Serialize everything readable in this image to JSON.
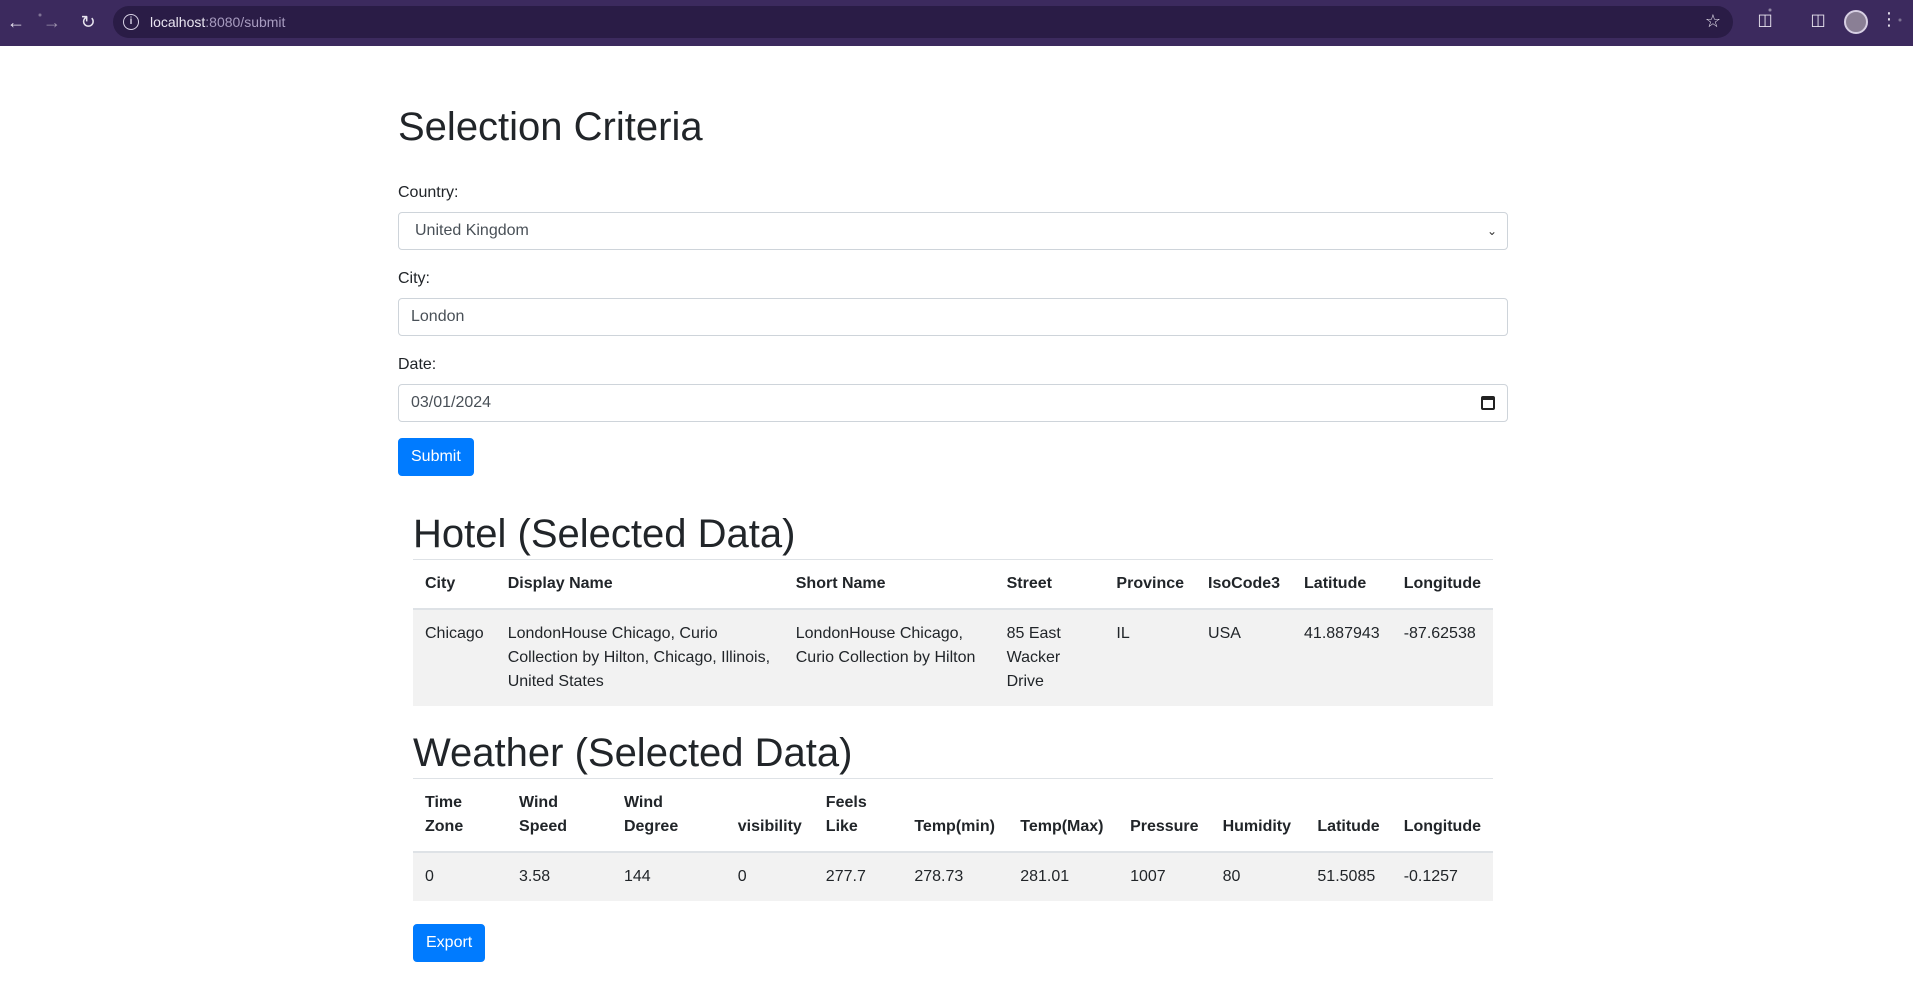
{
  "browser": {
    "url_host": "localhost",
    "url_path": ":8080/submit"
  },
  "form": {
    "title": "Selection Criteria",
    "country_label": "Country:",
    "country_value": "United Kingdom",
    "city_label": "City:",
    "city_value": "London",
    "date_label": "Date:",
    "date_value": "03/01/2024",
    "submit_label": "Submit"
  },
  "hotel": {
    "title": "Hotel (Selected Data)",
    "columns": [
      "City",
      "Display Name",
      "Short Name",
      "Street",
      "Province",
      "IsoCode3",
      "Latitude",
      "Longitude"
    ],
    "row": {
      "city": "Chicago",
      "display_name": "LondonHouse Chicago, Curio Collection by Hilton, Chicago, Illinois, United States",
      "short_name": "LondonHouse Chicago, Curio Collection by Hilton",
      "street": "85 East Wacker Drive",
      "province": "IL",
      "iso_code3": "USA",
      "latitude": "41.887943",
      "longitude": "-87.62538"
    }
  },
  "weather": {
    "title": "Weather (Selected Data)",
    "columns": [
      "Time Zone",
      "Wind Speed",
      "Wind Degree",
      "visibility",
      "Feels Like",
      "Temp(min)",
      "Temp(Max)",
      "Pressure",
      "Humidity",
      "Latitude",
      "Longitude"
    ],
    "row": {
      "time_zone": "0",
      "wind_speed": "3.58",
      "wind_degree": "144",
      "visibility": "0",
      "feels_like": "277.7",
      "temp_min": "278.73",
      "temp_max": "281.01",
      "pressure": "1007",
      "humidity": "80",
      "latitude": "51.5085",
      "longitude": "-0.1257"
    }
  },
  "export_label": "Export",
  "colors": {
    "primary": "#007bff",
    "browser_bar": "#3c2a5e",
    "row_stripe": "#f2f2f2"
  }
}
